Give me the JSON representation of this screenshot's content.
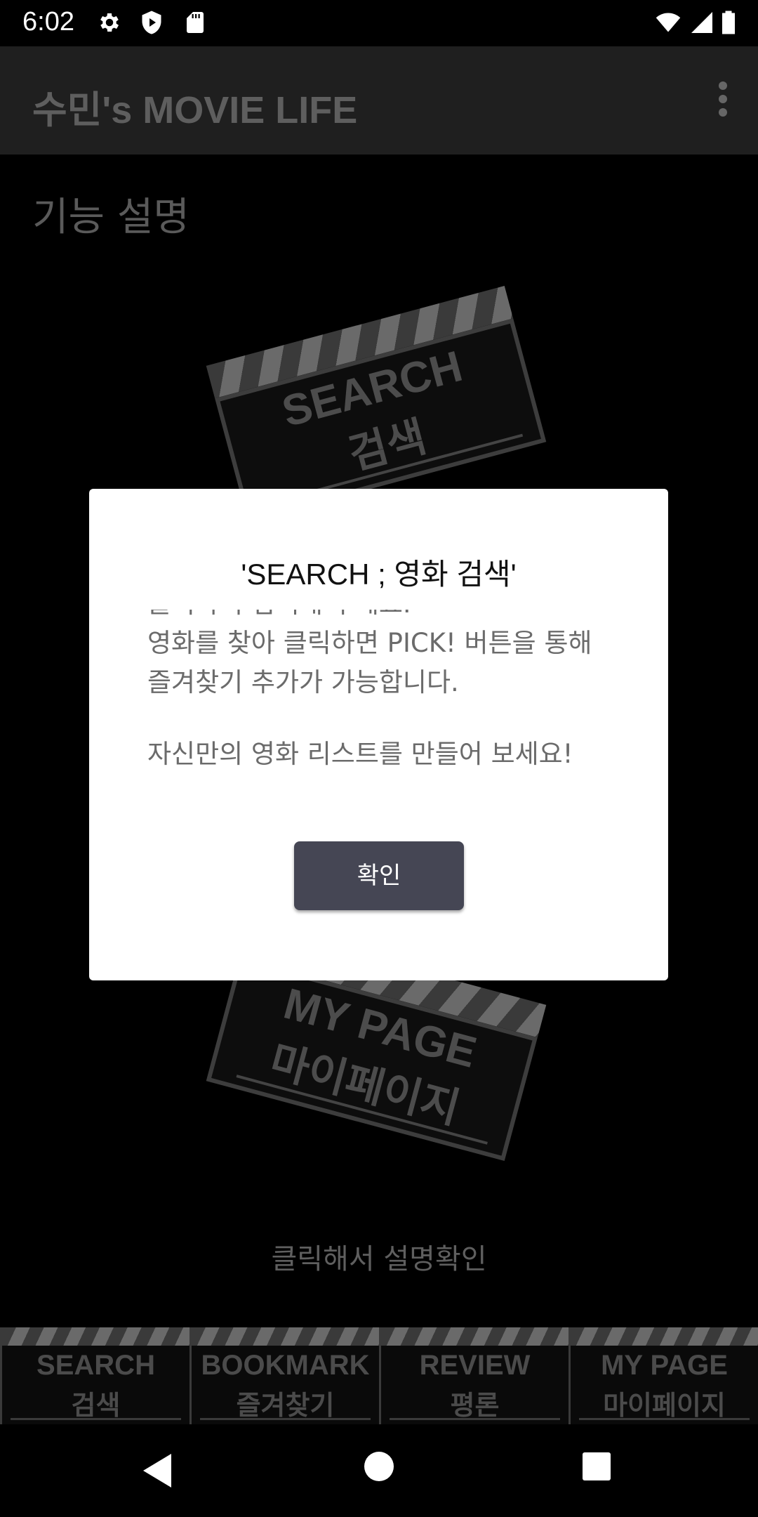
{
  "status_bar": {
    "time": "6:02"
  },
  "app_bar": {
    "title": "수민's MOVIE LIFE"
  },
  "content": {
    "section_title": "기능 설명",
    "clapboards": [
      {
        "line1": "SEARCH",
        "line2": "검색"
      },
      {
        "line1": "MY PAGE",
        "line2": "마이페이지"
      }
    ],
    "hint": "클릭해서 설명확인"
  },
  "tabs": [
    {
      "line1": "SEARCH",
      "line2": "검색"
    },
    {
      "line1": "BOOKMARK",
      "line2": "즐겨찾기"
    },
    {
      "line1": "REVIEW",
      "line2": "평론"
    },
    {
      "line1": "MY PAGE",
      "line2": "마이페이지"
    }
  ],
  "dialog": {
    "title": "'SEARCH ; 영화 검색'",
    "body_lines": [
      "클릭하여 검색해 주세요.",
      "영화를 찾아 클릭하면 PICK! 버튼을 통해",
      "즐겨찾기 추가가 가능합니다.",
      "",
      "자신만의 영화 리스트를 만들어 보세요!"
    ],
    "confirm_label": "확인"
  },
  "colors": {
    "dialog_button": "#454654",
    "app_bar": "#1f1f1f"
  }
}
